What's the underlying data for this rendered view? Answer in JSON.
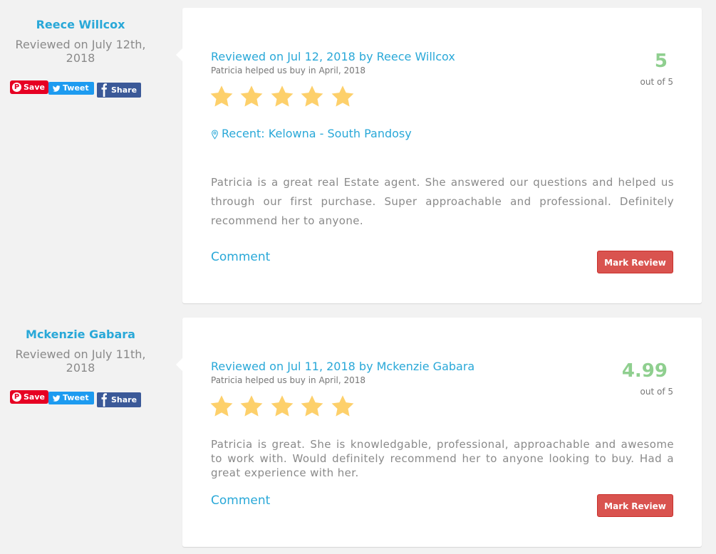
{
  "reviews": [
    {
      "author": "Reece Willcox",
      "reviewed_on": "Reviewed on July 12th, 2018",
      "share": {
        "save": "Save",
        "tweet": "Tweet",
        "share": "Share"
      },
      "title": "Reviewed on Jul 12, 2018 by Reece Willcox",
      "subtitle": "Patricia helped us buy in April, 2018",
      "score": "5",
      "out_of": "out of 5",
      "stars": 5,
      "location": "Recent: Kelowna - South Pandosy",
      "text": "Patricia is a great real Estate agent. She answered our questions and helped us through our first purchase. Super approachable and professional. Definitely recommend her to anyone.",
      "comment_label": "Comment",
      "mark_label": "Mark Review"
    },
    {
      "author": "Mckenzie Gabara",
      "reviewed_on": "Reviewed on July 11th, 2018",
      "share": {
        "save": "Save",
        "tweet": "Tweet",
        "share": "Share"
      },
      "title": "Reviewed on Jul 11, 2018 by Mckenzie Gabara",
      "subtitle": "Patricia helped us buy in April, 2018",
      "score": "4.99",
      "out_of": "out of 5",
      "stars": 5,
      "text": "Patricia is great. She is knowledgable, professional, approachable and awesome to work with. Would definitely recommend her to anyone looking to buy. Had a great experience with her.",
      "comment_label": "Comment",
      "mark_label": "Mark Review"
    }
  ],
  "colors": {
    "accent": "#29a8d8",
    "score": "#8fcf8f",
    "star": "#fdd06b",
    "mark_button": "#d9534f",
    "pinterest": "#e60023",
    "twitter": "#1d9bf0",
    "facebook": "#3b5998"
  },
  "icons": {
    "save": "pinterest-icon",
    "tweet": "twitter-bird-icon",
    "share": "facebook-icon",
    "location": "map-pin-icon",
    "star": "star-icon"
  }
}
